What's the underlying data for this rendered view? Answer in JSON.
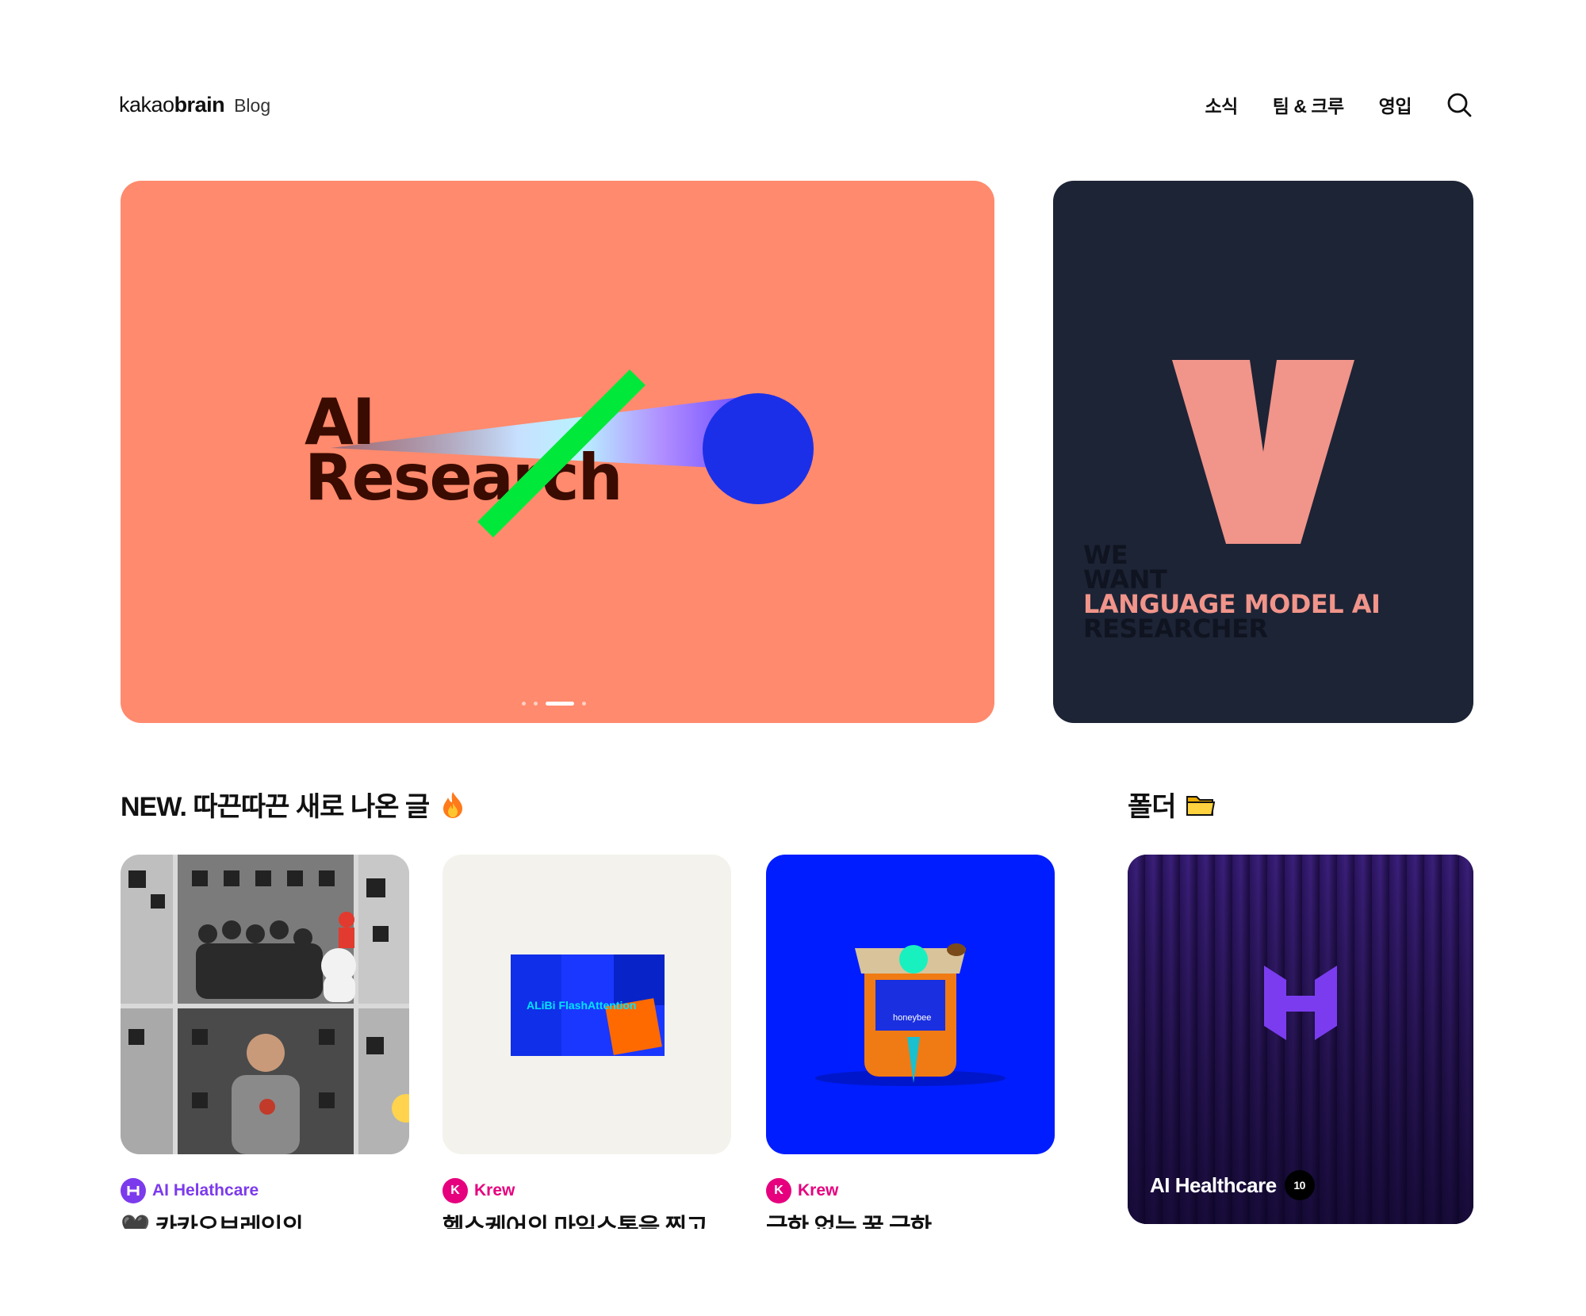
{
  "header": {
    "logo_prefix": "kakao",
    "logo_bold": "brain",
    "logo_suffix": "Blog",
    "nav": [
      {
        "label": "소식"
      },
      {
        "label": "팀 & 크루"
      },
      {
        "label": "영입"
      }
    ],
    "search_icon": "search-icon"
  },
  "hero": {
    "main": {
      "title_line1": "AI",
      "title_line2": "Research",
      "background": "#ff8a6d",
      "slide_count": 4,
      "active_slide": 3
    },
    "side": {
      "letter": "V",
      "line1": "WE",
      "line2": "WANT",
      "line3": "LANGUAGE MODEL AI",
      "line4": "RESEARCHER",
      "background": "#1d2436"
    }
  },
  "new_section": {
    "title": "NEW. 따끈따끈 새로 나온 글",
    "emoji": "fire-icon",
    "cards": [
      {
        "tag": "AI Helathcare",
        "tag_color": "#7c3aed",
        "title": "🖤 카카오브레인의",
        "thumb_desc": "photo-collage"
      },
      {
        "tag": "Krew",
        "tag_color": "#e6007e",
        "title": "헬스케어의 마일스톤을 찍고",
        "thumb_text": "ALiBi FlashAttention"
      },
      {
        "tag": "Krew",
        "tag_color": "#e6007e",
        "title": "극한 없는 꿀 극한",
        "thumb_text": "honeybee"
      }
    ]
  },
  "folder_section": {
    "title": "폴더",
    "emoji": "folder-icon",
    "folder": {
      "label": "AI Healthcare",
      "count": "10"
    }
  }
}
